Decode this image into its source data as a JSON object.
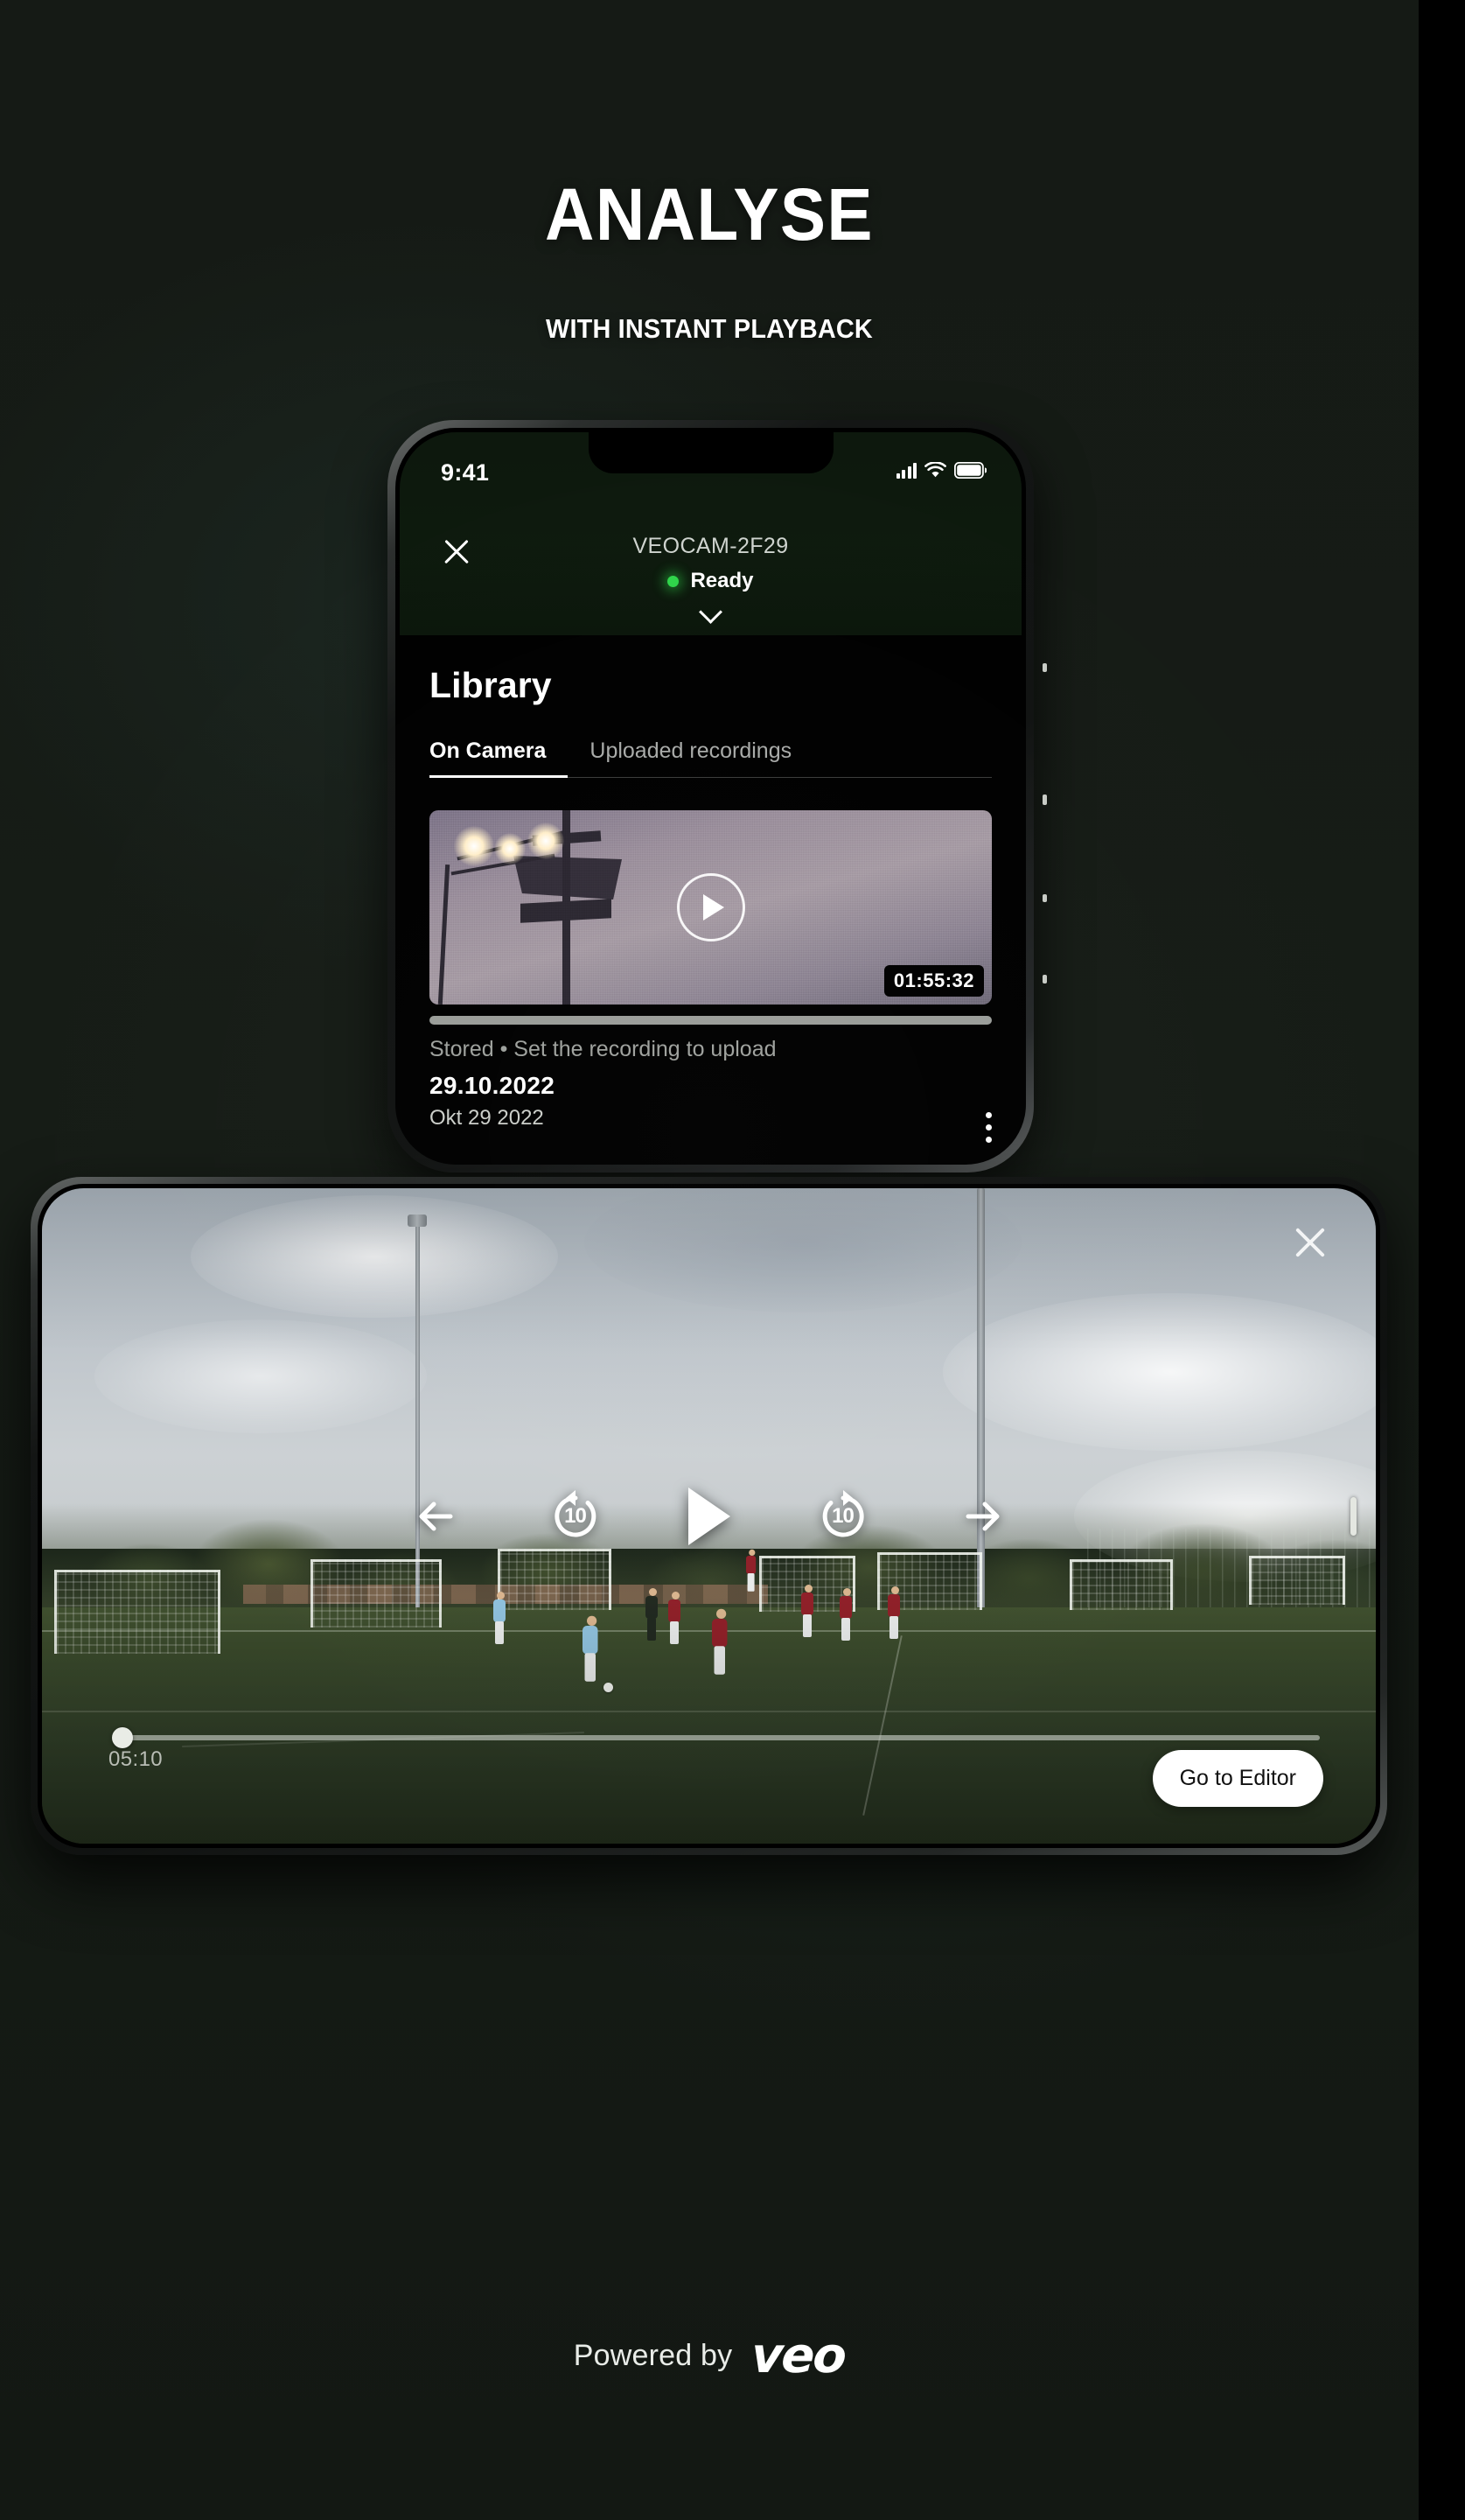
{
  "theme": {
    "bg": "#161B16",
    "accent_green": "#2FD44A",
    "text_primary": "#FFFFFF",
    "text_muted": "#9EA19D",
    "button_bg": "#FFFFFF"
  },
  "hero": {
    "title": "ANALYSE",
    "subtitle": "WITH INSTANT PLAYBACK"
  },
  "phone_portrait": {
    "status_bar": {
      "time": "9:41",
      "signal_icon": "cellular-signal-icon",
      "wifi_icon": "wifi-icon",
      "battery_icon": "battery-icon"
    },
    "header": {
      "close_icon": "close-icon",
      "camera_name": "VEOCAM-2F29",
      "status_label": "Ready",
      "status_dot": "status-dot-green",
      "expand_icon": "chevron-down-icon"
    },
    "library": {
      "title": "Library",
      "tabs": [
        {
          "label": "On Camera",
          "active": true
        },
        {
          "label": "Uploaded recordings",
          "active": false
        }
      ],
      "recording": {
        "thumbnail_play_icon": "play-icon",
        "duration": "01:55:32",
        "upload_status": "Stored • Set the recording to upload",
        "date": "29.10.2022",
        "date_long": "Okt 29 2022",
        "menu_icon": "kebab-menu-icon"
      }
    }
  },
  "phone_landscape": {
    "close_icon": "close-icon",
    "controls": {
      "prev_icon": "arrow-left-icon",
      "rewind_icon": "rewind-10-icon",
      "rewind_label": "10",
      "play_icon": "play-icon",
      "forward_icon": "forward-10-icon",
      "forward_label": "10",
      "next_icon": "arrow-right-icon",
      "edge_handle_icon": "drag-handle-icon"
    },
    "timeline": {
      "current_time": "05:10",
      "progress_percent": 1
    },
    "editor_button": "Go to Editor"
  },
  "footer": {
    "powered_by": "Powered by",
    "brand": "veo"
  }
}
